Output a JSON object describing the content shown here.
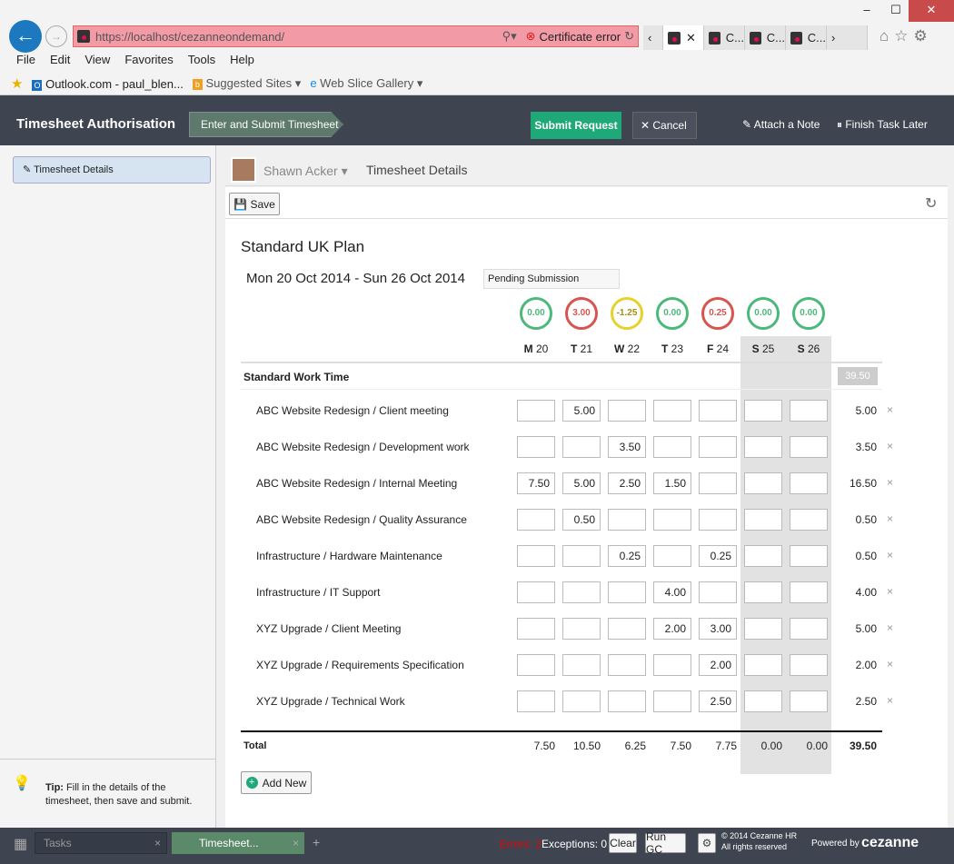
{
  "browser": {
    "url": "https://localhost/cezanneondemand/",
    "cert_error": "Certificate error",
    "tabs": [
      "",
      "C...",
      "C...",
      "C..."
    ],
    "menu": [
      "File",
      "Edit",
      "View",
      "Favorites",
      "Tools",
      "Help"
    ],
    "favorites": [
      "Outlook.com - paul_blen...",
      "Suggested Sites",
      "Web Slice Gallery"
    ]
  },
  "header": {
    "title": "Timesheet Authorisation",
    "step": "Enter and Submit Timesheet",
    "submit": "Submit Request",
    "cancel": "Cancel",
    "attach": "Attach a Note",
    "finish": "Finish Task Later"
  },
  "sidebar": {
    "item": "Timesheet Details",
    "tip_label": "Tip:",
    "tip": "Fill in the details of the timesheet, then save and submit."
  },
  "breadcrumb": {
    "user": "Shawn Acker",
    "page": "Timesheet Details"
  },
  "toolbar": {
    "save": "Save"
  },
  "timesheet": {
    "plan": "Standard UK Plan",
    "period": "Mon 20 Oct 2014 - Sun 26 Oct 2014",
    "status": "Pending Submission",
    "days": [
      {
        "d": "M",
        "n": "20",
        "bal": "0.00",
        "c": "green"
      },
      {
        "d": "T",
        "n": "21",
        "bal": "3.00",
        "c": "red"
      },
      {
        "d": "W",
        "n": "22",
        "bal": "-1.25",
        "c": "yellow"
      },
      {
        "d": "T",
        "n": "23",
        "bal": "0.00",
        "c": "green"
      },
      {
        "d": "F",
        "n": "24",
        "bal": "0.25",
        "c": "red"
      },
      {
        "d": "S",
        "n": "25",
        "bal": "0.00",
        "c": "green"
      },
      {
        "d": "S",
        "n": "26",
        "bal": "0.00",
        "c": "green"
      }
    ],
    "section": "Standard Work Time",
    "section_total": "39.50",
    "rows": [
      {
        "name": "ABC Website Redesign / Client meeting",
        "vals": [
          "",
          "5.00",
          "",
          "",
          "",
          "",
          ""
        ],
        "total": "5.00"
      },
      {
        "name": "ABC Website Redesign / Development work",
        "vals": [
          "",
          "",
          "3.50",
          "",
          "",
          "",
          ""
        ],
        "total": "3.50"
      },
      {
        "name": "ABC Website Redesign / Internal Meeting",
        "vals": [
          "7.50",
          "5.00",
          "2.50",
          "1.50",
          "",
          "",
          ""
        ],
        "total": "16.50"
      },
      {
        "name": "ABC Website Redesign / Quality Assurance",
        "vals": [
          "",
          "0.50",
          "",
          "",
          "",
          "",
          ""
        ],
        "total": "0.50"
      },
      {
        "name": "Infrastructure / Hardware Maintenance",
        "vals": [
          "",
          "",
          "0.25",
          "",
          "0.25",
          "",
          ""
        ],
        "total": "0.50"
      },
      {
        "name": "Infrastructure / IT Support",
        "vals": [
          "",
          "",
          "",
          "4.00",
          "",
          "",
          ""
        ],
        "total": "4.00"
      },
      {
        "name": "XYZ Upgrade / Client Meeting",
        "vals": [
          "",
          "",
          "",
          "2.00",
          "3.00",
          "",
          ""
        ],
        "total": "5.00"
      },
      {
        "name": "XYZ Upgrade / Requirements Specification",
        "vals": [
          "",
          "",
          "",
          "",
          "2.00",
          "",
          ""
        ],
        "total": "2.00"
      },
      {
        "name": "XYZ Upgrade / Technical Work",
        "vals": [
          "",
          "",
          "",
          "",
          "2.50",
          "",
          ""
        ],
        "total": "2.50"
      }
    ],
    "total_label": "Total",
    "totals": [
      "7.50",
      "10.50",
      "6.25",
      "7.50",
      "7.75",
      "0.00",
      "0.00"
    ],
    "grand_total": "39.50",
    "add_new": "Add New"
  },
  "footer": {
    "tasks": "Tasks",
    "active": "Timesheet...",
    "errors": "Errors: 2",
    "exceptions": "Exceptions: 0",
    "clear": "Clear",
    "rungc": "Run GC",
    "copyright": "© 2014 Cezanne HR",
    "rights": "All rights reserved",
    "powered": "Powered by",
    "brand": "cezanne"
  },
  "colors": {
    "green": "#4cb87a",
    "red": "#d9534f",
    "yellow": "#e6d22a",
    "submit": "#1fa878"
  }
}
